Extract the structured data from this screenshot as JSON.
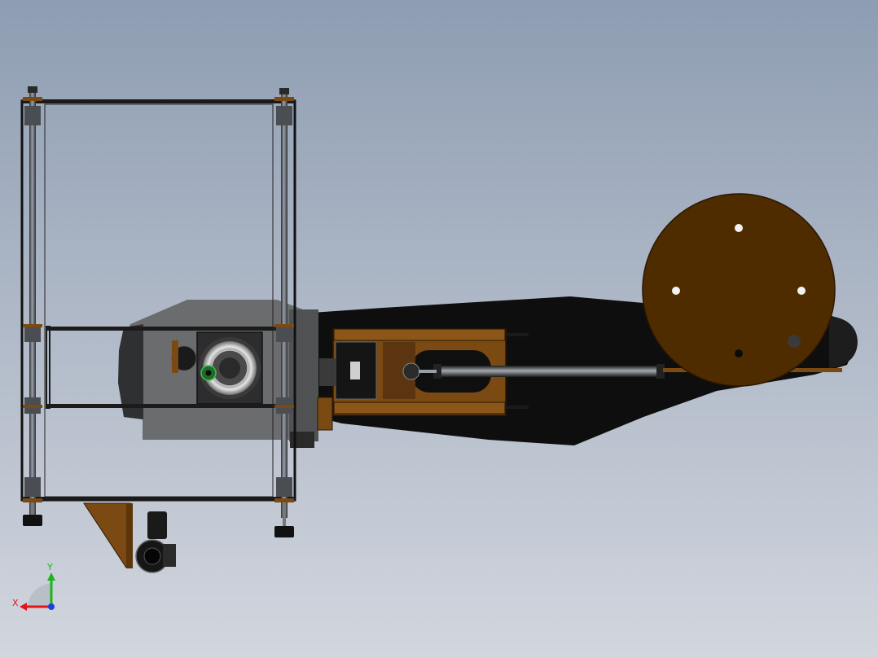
{
  "viewport": {
    "background_top": "#8e9db2",
    "background_bottom": "#d2d6de"
  },
  "colors": {
    "frame_line": "#111111",
    "rod_dark": "#3b3e44",
    "rod_light": "#8a8f97",
    "housing_grey": "#6b6c6e",
    "housing_dark": "#3c3c3e",
    "arm_black": "#0e0e0e",
    "bronze": "#7a4a12",
    "bronze_dark": "#4e2c06",
    "disc_brown": "#4f2c00",
    "bearing_light": "#d9d9d9",
    "axis_x": "#e0161b",
    "axis_y": "#1bb51b",
    "axis_z": "#1f3ee0"
  },
  "triad": {
    "x_label": "X",
    "y_label": "Y"
  }
}
